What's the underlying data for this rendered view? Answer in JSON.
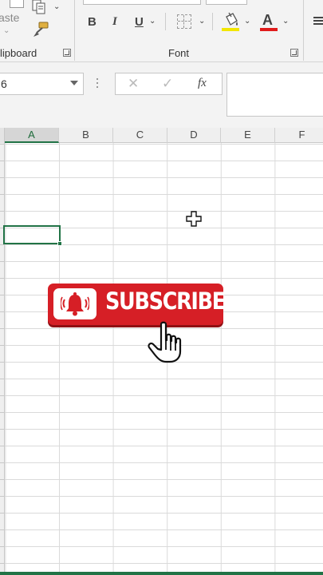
{
  "ribbon": {
    "clipboard": {
      "paste_label": "aste",
      "group_label": "lipboard"
    },
    "font": {
      "group_label": "Font",
      "bold_label": "B",
      "italic_label": "I",
      "underline_label": "U",
      "font_color_letter": "A",
      "fill_color": "#f2e600",
      "font_color": "#e01b1b"
    }
  },
  "formula_bar": {
    "name_box_value": "6",
    "cancel_symbol": "✕",
    "enter_symbol": "✓",
    "fx_label": "fx",
    "formula_value": ""
  },
  "grid": {
    "columns": [
      "A",
      "B",
      "C",
      "D",
      "E",
      "F"
    ],
    "active_column": "A"
  },
  "overlay": {
    "subscribe_text": "SUBSCRIBE",
    "button_color": "#d61f26",
    "icons": [
      "bell-icon",
      "hand-pointer-icon",
      "cell-cursor-plus-icon"
    ]
  },
  "theme": {
    "accent": "#217346"
  }
}
